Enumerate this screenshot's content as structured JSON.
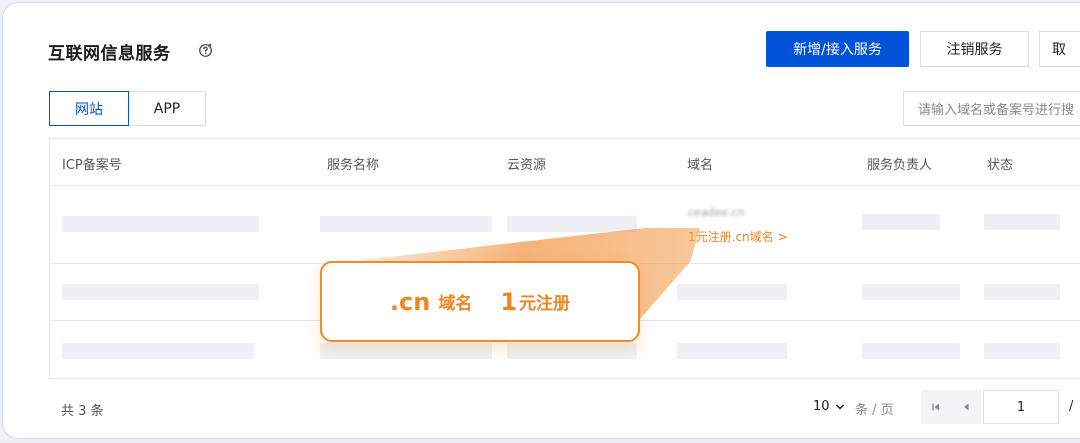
{
  "page": {
    "title": "互联网信息服务"
  },
  "toolbar": {
    "add_label": "新增/接入服务",
    "cancel_label": "注销服务",
    "more_label": "取"
  },
  "tabs": [
    {
      "label": "网站"
    },
    {
      "label": "APP"
    }
  ],
  "search": {
    "placeholder": "请输入域名或备案号进行搜"
  },
  "table": {
    "columns": [
      "ICP备案号",
      "服务名称",
      "云资源",
      "域名",
      "服务负责人",
      "状态"
    ],
    "rows": [
      {
        "domain": "ceadee.cn",
        "promo_link": "1元注册.cn域名 >"
      }
    ]
  },
  "callout": {
    "domain_suffix": ".cn",
    "domain_word": "域名",
    "price_number": "1",
    "price_unit": "元注册"
  },
  "footer": {
    "total": "共 3 条",
    "page_size": "10",
    "per_page_label": "条 / 页",
    "current_page": "1",
    "slash": "/"
  },
  "colors": {
    "primary": "#0052d9",
    "accent": "#f08622"
  },
  "icons": {
    "help": "help-icon",
    "dropdown": "chevron-down-icon",
    "first": "first-page-icon",
    "prev": "prev-page-icon"
  }
}
